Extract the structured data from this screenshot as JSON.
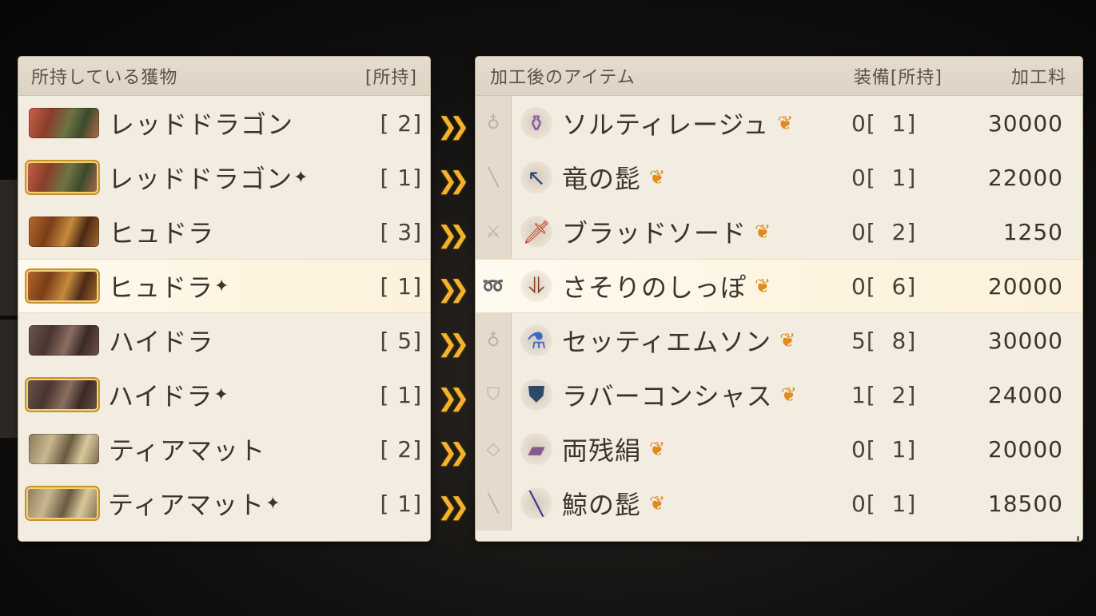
{
  "left": {
    "header_title": "所持している獲物",
    "header_owned": "[所持]",
    "rows": [
      {
        "name": "レッドドラゴン",
        "sparkle": "",
        "count": "[  2]",
        "icon": "red-dragon-icon",
        "gold": false
      },
      {
        "name": "レッドドラゴン",
        "sparkle": "✦",
        "count": "[  1]",
        "icon": "red-dragon-plus-icon",
        "gold": true
      },
      {
        "name": "ヒュドラ",
        "sparkle": "",
        "count": "[  3]",
        "icon": "hydra-icon",
        "gold": false
      },
      {
        "name": "ヒュドラ",
        "sparkle": "✦",
        "count": "[  1]",
        "icon": "hydra-plus-icon",
        "gold": true
      },
      {
        "name": "ハイドラ",
        "sparkle": "",
        "count": "[  5]",
        "icon": "hydra-brown-icon",
        "gold": false
      },
      {
        "name": "ハイドラ",
        "sparkle": "✦",
        "count": "[  1]",
        "icon": "hydra-brown-plus-icon",
        "gold": true
      },
      {
        "name": "ティアマット",
        "sparkle": "",
        "count": "[  2]",
        "icon": "tiamat-icon",
        "gold": false
      },
      {
        "name": "ティアマット",
        "sparkle": "✦",
        "count": "[  1]",
        "icon": "tiamat-plus-icon",
        "gold": true
      }
    ]
  },
  "right": {
    "header_title": "加工後のアイテム",
    "header_equip": "装備[所持]",
    "header_fee": "加工料",
    "rows": [
      {
        "name": "ソルティレージュ",
        "equip": "0[  1]",
        "fee": "30000",
        "slot_icon": "accessory-icon",
        "item_icon": "potion-icon"
      },
      {
        "name": "竜の髭",
        "equip": "0[  1]",
        "fee": "22000",
        "slot_icon": "spear-slot-icon",
        "item_icon": "spear-icon"
      },
      {
        "name": "ブラッドソード",
        "equip": "0[  2]",
        "fee": "1250",
        "slot_icon": "sword-slot-icon",
        "item_icon": "sword-icon"
      },
      {
        "name": "さそりのしっぽ",
        "equip": "0[  6]",
        "fee": "20000",
        "slot_icon": "whip-slot-icon",
        "item_icon": "whip-icon"
      },
      {
        "name": "セッティエムソン",
        "equip": "5[  8]",
        "fee": "30000",
        "slot_icon": "accessory-icon",
        "item_icon": "flask-icon"
      },
      {
        "name": "ラバーコンシャス",
        "equip": "1[  2]",
        "fee": "24000",
        "slot_icon": "armor-slot-icon",
        "item_icon": "armor-icon"
      },
      {
        "name": "両残絹",
        "equip": "0[  1]",
        "fee": "20000",
        "slot_icon": "cloth-slot-icon",
        "item_icon": "cloth-icon"
      },
      {
        "name": "鯨の髭",
        "equip": "0[  1]",
        "fee": "18500",
        "slot_icon": "rod-slot-icon",
        "item_icon": "rod-icon"
      }
    ]
  },
  "selected_index": 3,
  "colors": {
    "panel": "#f3ece0",
    "arrow": "#f2b32e",
    "craft_icon": "#e08a20"
  }
}
